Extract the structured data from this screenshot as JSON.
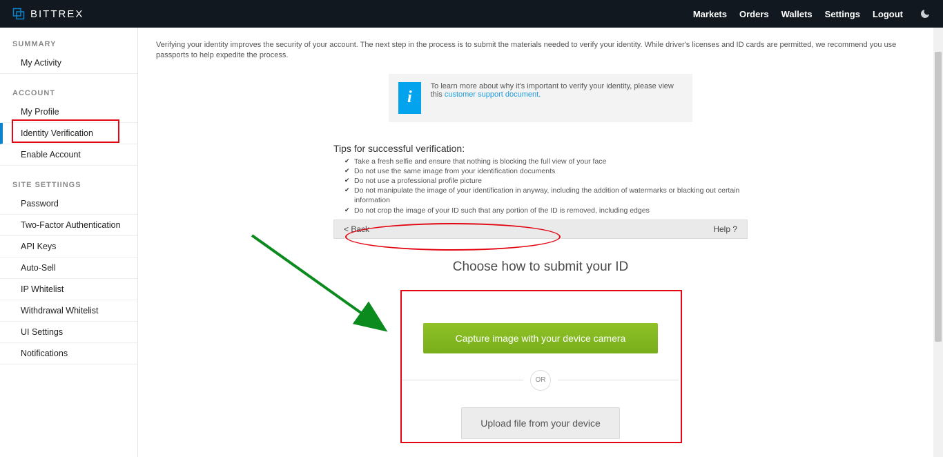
{
  "header": {
    "brand": "BITTREX",
    "nav": [
      "Markets",
      "Orders",
      "Wallets",
      "Settings",
      "Logout"
    ]
  },
  "sidebar": {
    "groups": [
      {
        "title": "SUMMARY",
        "items": [
          "My Activity"
        ]
      },
      {
        "title": "ACCOUNT",
        "items": [
          "My Profile",
          "Identity Verification",
          "Enable Account"
        ],
        "activeIndex": 1
      },
      {
        "title": "SITE SETTIINGS",
        "items": [
          "Password",
          "Two-Factor Authentication",
          "API Keys",
          "Auto-Sell",
          "IP Whitelist",
          "Withdrawal Whitelist",
          "UI Settings",
          "Notifications"
        ]
      }
    ]
  },
  "content": {
    "intro": "Verifying your identity improves the security of your account. The next step in the process is to submit the materials needed to verify your identity. While driver's licenses and ID cards are permitted, we recommend you use passports to help expedite the process.",
    "info": {
      "lead": "To learn more about why it's important to verify your identity, please view this ",
      "link": "customer support document.",
      "icon_label": "i"
    },
    "tips_title": "Tips for successful verification:",
    "tips": [
      "Take a fresh selfie and ensure that nothing is blocking the full view of your face",
      "Do not use the same image from your identification documents",
      "Do not use a professional profile picture",
      "Do not manipulate the image of your identification in anyway, including the addition of watermarks or blacking out certain information",
      "Do not crop the image of your ID such that any portion of the ID is removed, including edges"
    ],
    "bar": {
      "back": "< Back",
      "help": "Help ?"
    },
    "choose_title": "Choose how to submit your ID",
    "btn_camera": "Capture image with your device camera",
    "or_label": "OR",
    "btn_upload": "Upload file from your device"
  }
}
